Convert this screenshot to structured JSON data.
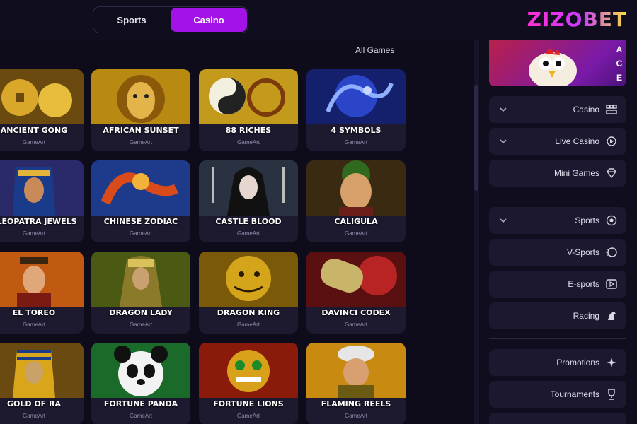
{
  "header": {
    "logo": "ZIZOBET",
    "tabs": [
      {
        "label": "Sports",
        "active": false
      },
      {
        "label": "Casino",
        "active": true
      }
    ]
  },
  "main": {
    "section_title": "All Games",
    "games": [
      {
        "name": "4 Symbols",
        "provider": "GameArt"
      },
      {
        "name": "88 Riches",
        "provider": "GameArt"
      },
      {
        "name": "African Sunset",
        "provider": "GameArt"
      },
      {
        "name": "Ancient Gong",
        "provider": "GameArt"
      },
      {
        "name": "Caligula",
        "provider": "GameArt"
      },
      {
        "name": "Castle Blood",
        "provider": "GameArt"
      },
      {
        "name": "Chinese Zodiac",
        "provider": "GameArt"
      },
      {
        "name": "Cleopatra Jewels",
        "provider": "GameArt"
      },
      {
        "name": "Davinci Codex",
        "provider": "GameArt"
      },
      {
        "name": "Dragon King",
        "provider": "GameArt"
      },
      {
        "name": "Dragon Lady",
        "provider": "GameArt"
      },
      {
        "name": "El Toreo",
        "provider": "GameArt"
      },
      {
        "name": "Flaming Reels",
        "provider": "GameArt"
      },
      {
        "name": "Fortune Lions",
        "provider": "GameArt"
      },
      {
        "name": "Fortune Panda",
        "provider": "GameArt"
      },
      {
        "name": "Gold of Ra",
        "provider": "GameArt"
      }
    ]
  },
  "sidebar": {
    "banner_letters": [
      "A",
      "C",
      "E"
    ],
    "items": [
      {
        "label": "Casino",
        "icon": "dice-grid-icon",
        "expandable": true
      },
      {
        "label": "Live Casino",
        "icon": "live-casino-icon",
        "expandable": true
      },
      {
        "label": "Mini Games",
        "icon": "diamond-icon",
        "expandable": false
      },
      {
        "label": "Sports",
        "icon": "soccer-ball-icon",
        "expandable": true
      },
      {
        "label": "V-Sports",
        "icon": "v-sports-icon",
        "expandable": false
      },
      {
        "label": "E-sports",
        "icon": "esports-icon",
        "expandable": false
      },
      {
        "label": "Racing",
        "icon": "horse-icon",
        "expandable": false
      },
      {
        "label": "Promotions",
        "icon": "sparkle-icon",
        "expandable": false
      },
      {
        "label": "Tournaments",
        "icon": "trophy-icon",
        "expandable": false
      }
    ]
  },
  "colors": {
    "accent": "#a313e8",
    "background": "#0e0c1a",
    "card": "#1d1a30"
  }
}
